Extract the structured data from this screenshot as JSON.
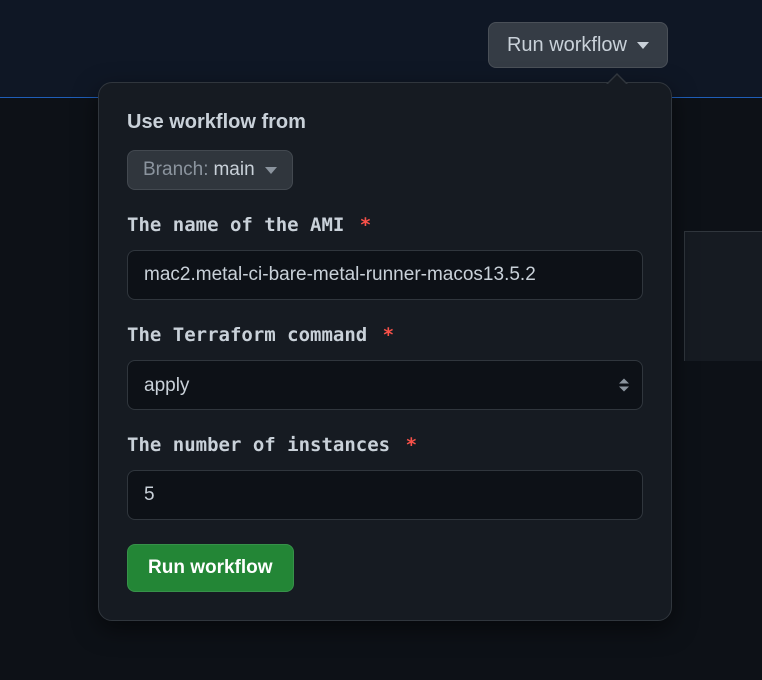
{
  "trigger": {
    "label": "Run workflow"
  },
  "popover": {
    "section_title": "Use workflow from",
    "branch_prefix": "Branch:",
    "branch_name": "main",
    "fields": {
      "ami": {
        "label": "The name of the AMI",
        "value": "mac2.metal-ci-bare-metal-runner-macos13.5.2"
      },
      "tf_command": {
        "label": "The Terraform command",
        "value": "apply"
      },
      "instances": {
        "label": "The number of instances",
        "value": "5"
      }
    },
    "submit_label": "Run workflow",
    "required_marker": "*"
  }
}
